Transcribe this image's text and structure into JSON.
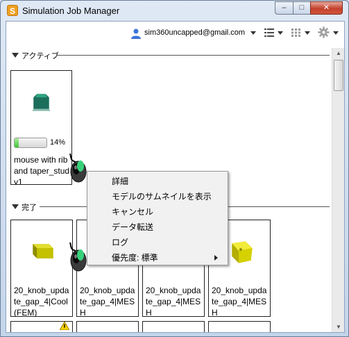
{
  "window": {
    "title": "Simulation Job Manager",
    "app_icon_letter": "S",
    "minimize_glyph": "–",
    "maximize_glyph": "□",
    "close_glyph": "✕"
  },
  "toolbar": {
    "user_email": "sim360uncapped@gmail.com",
    "icons": [
      "user-icon",
      "list-view-icon",
      "grid-view-icon",
      "gear-icon"
    ]
  },
  "sections": {
    "active": {
      "label": "アクティブ",
      "jobs": [
        {
          "name": "mouse with rib and taper_study1",
          "progress": 0.14,
          "progress_label": "14%",
          "thumbnail_color": "#1c6e5c"
        }
      ]
    },
    "done": {
      "label": "完了",
      "jobs": [
        {
          "name": "20_knob_update_gap_4|Cool (FEM)",
          "thumbnail_color": "#b9b600"
        },
        {
          "name": "20_knob_update_gap_4|MESH",
          "thumbnail_color": "#b9b600"
        },
        {
          "name": "20_knob_update_gap_4|MESH",
          "thumbnail_color": "#b9b600"
        },
        {
          "name": "20_knob_update_gap_4|MESH",
          "thumbnail_color": "#d9d400"
        }
      ]
    }
  },
  "context_menu": {
    "items": [
      {
        "label": "詳細"
      },
      {
        "label": "モデルのサムネイルを表示"
      },
      {
        "label": "キャンセル"
      },
      {
        "label": "データ転送"
      },
      {
        "label": "ログ"
      },
      {
        "label": "優先度: 標準",
        "has_submenu": true
      }
    ]
  },
  "colors": {
    "progress": "#3fc734",
    "accent_blue": "#2d6bd6",
    "window_close": "#c4412c"
  }
}
